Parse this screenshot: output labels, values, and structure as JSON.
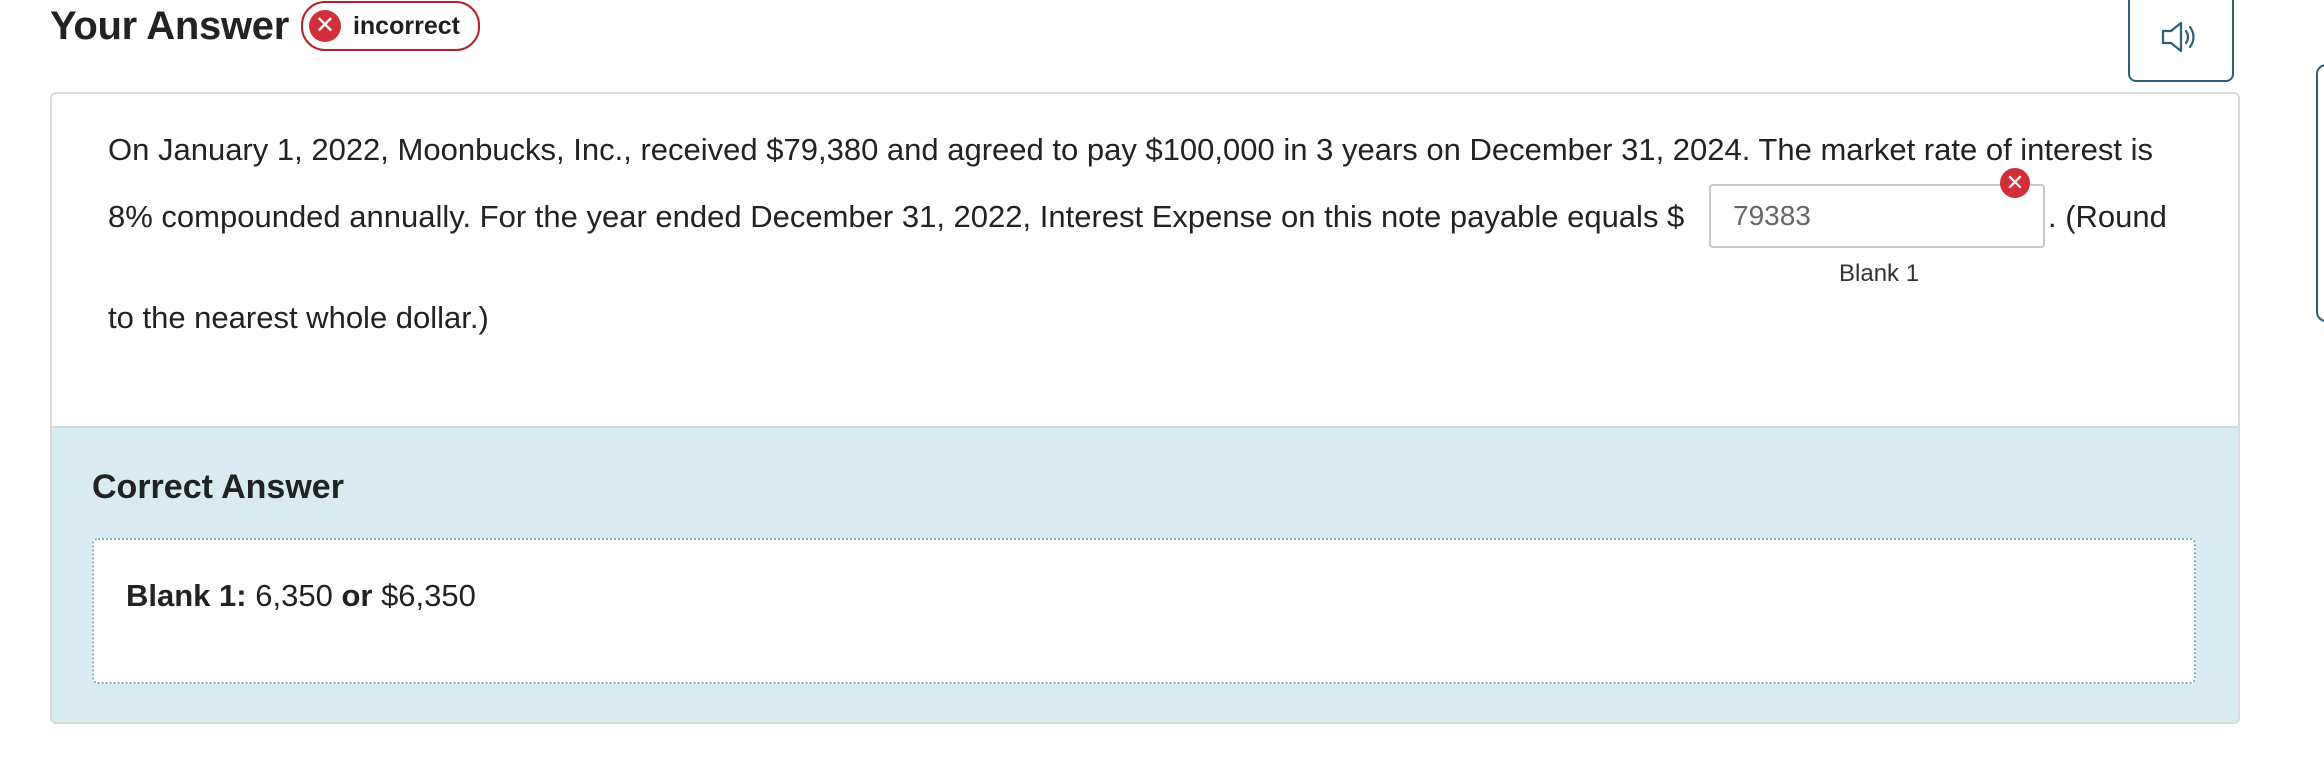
{
  "header": {
    "title": "Your Answer",
    "status_label": "incorrect",
    "status_icon": "x-circle-icon"
  },
  "audio": {
    "icon": "speaker-icon"
  },
  "question": {
    "line1": "On January 1, 2022, Moonbucks, Inc., received $79,380 and agreed to pay $100,000 in 3 years on December 31, 2024. The market rate of interest is",
    "line2_before": "8% compounded annually. For the year ended December 31, 2022, Interest Expense on this note payable equals $",
    "blank_value": "79383",
    "blank_label": "Blank 1",
    "line2_after": ". (Round",
    "line3": "to the nearest whole dollar.)"
  },
  "correct": {
    "title": "Correct Answer",
    "blank_label": "Blank 1:",
    "value1": "6,350",
    "or_text": "or",
    "value2": "$6,350"
  },
  "colors": {
    "incorrect_red": "#d1303a",
    "accent_navy": "#2f5d7a",
    "correct_bg": "#d8ebf0"
  }
}
